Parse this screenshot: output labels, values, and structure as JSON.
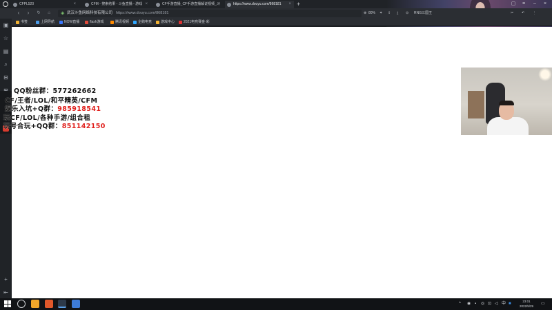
{
  "browser": {
    "tabs": [
      {
        "label": "CFPL520",
        "active": false
      },
      {
        "label": "CFM - 搜索结果 - 斗鱼直播 - 游戏",
        "active": false
      },
      {
        "label": "CF手游直播_CF手游直播解说视频_斗",
        "active": false
      },
      {
        "label": "https://www.douyu.com/868181",
        "active": true
      }
    ],
    "url_company": "武汉斗鱼网络科技有限公司",
    "url": "https://www.douyu.com/868181",
    "zoom": "80%",
    "profile": "RNG三国王",
    "bookmarks": [
      {
        "label": "书签",
        "color": "#f2b233"
      },
      {
        "label": "上网导航",
        "color": "#4a9be8"
      },
      {
        "label": "NOW直播",
        "color": "#3a78ff"
      },
      {
        "label": "flash游戏",
        "color": "#e04a3a"
      },
      {
        "label": "腾讯视频",
        "color": "#ff8a00"
      },
      {
        "label": "企鹅电竞",
        "color": "#2fa7ff"
      },
      {
        "label": "游戏中心",
        "color": "#f2b233"
      },
      {
        "label": "2021电竞赛金·彩",
        "color": "#d33"
      }
    ]
  },
  "overlay": {
    "line1": "QQ粉丝群：577262662",
    "line2": "CF/王者/LOL/和平精英/CFM",
    "line3_label": "娱乐入坑+Q群：",
    "line3_value": "985918541",
    "line4": "玩CF/LOL/各种手游/组合租",
    "line5_label": "玩号合玩+QQ群：",
    "line5_value": "851142150"
  },
  "taskbar": {
    "time": "23:01",
    "date": "2022/5/29"
  },
  "colors": {
    "accent_red": "#e0201c",
    "chrome_dark": "#202327",
    "page_bg": "#ffffff"
  }
}
